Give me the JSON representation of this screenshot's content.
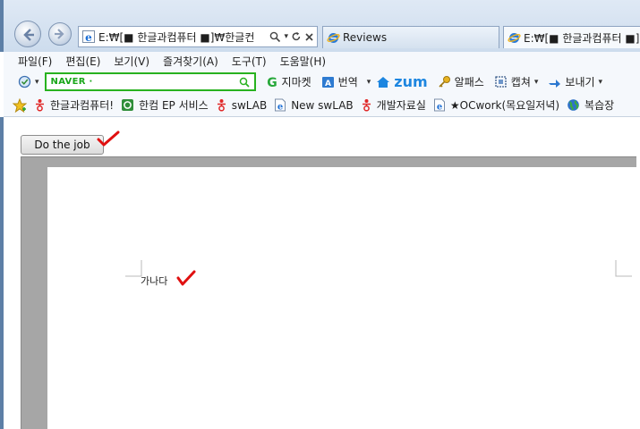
{
  "browser": {
    "address": "E:₩[■ 한글과컴퓨터 ■]₩한글컨",
    "address_tools": [
      "search-icon",
      "dropdown",
      "refresh-icon",
      "stop-icon"
    ],
    "tabs": [
      {
        "label": "Reviews",
        "icon": "ie-icon"
      },
      {
        "label": "E:₩[■ 한글과컴퓨터 ■]",
        "icon": "ie-icon"
      }
    ]
  },
  "menubar": {
    "items": [
      "파일(F)",
      "편집(E)",
      "보기(V)",
      "즐겨찾기(A)",
      "도구(T)",
      "도움말(H)"
    ]
  },
  "commandbar": {
    "naver_placeholder": "NAVER ·",
    "gmarket": "지마켓",
    "translate": "번역",
    "zum": "zum",
    "alpass": "알패스",
    "capture": "캡쳐",
    "send": "보내기",
    "accent_colors": {
      "naver": "#28b21f",
      "zum": "#1d86e0"
    }
  },
  "favorites": {
    "items": [
      {
        "label": "한글과컴퓨터!",
        "icon": "hancom-icon"
      },
      {
        "label": "한컴 EP 서비스",
        "icon": "ep-icon"
      },
      {
        "label": "swLAB",
        "icon": "hancom-icon"
      },
      {
        "label": "New swLAB",
        "icon": "ie-page-icon"
      },
      {
        "label": "개발자료실",
        "icon": "hancom-icon"
      },
      {
        "label": "★OCwork(목요일저녁)",
        "icon": "ie-page-icon"
      },
      {
        "label": "복습장",
        "icon": "globe-icon"
      }
    ]
  },
  "page": {
    "button_label": "Do the job",
    "document_text": "가나다"
  }
}
